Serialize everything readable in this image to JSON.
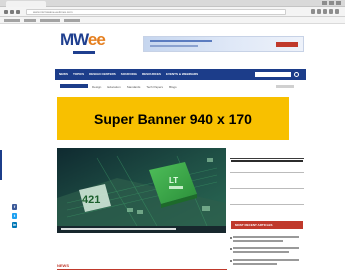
{
  "browser": {
    "url": "www.microwave-eetimes.com",
    "colors": {
      "chrome": "#d9d9d9",
      "toolbar": "#f4f4f4"
    }
  },
  "site": {
    "logo_primary": "MW",
    "logo_accent": "ee",
    "colors": {
      "brand_blue": "#1c3d8a",
      "accent_orange": "#e57f1f",
      "banner_yellow": "#f8c000",
      "accent_red": "#c0392b"
    }
  },
  "nav": {
    "items": [
      "NEWS",
      "TOPICS",
      "DESIGN CENTERS",
      "SOURCING",
      "RESOURCES",
      "EVENTS & WEBINARS"
    ],
    "search_placeholder": ""
  },
  "subnav": {
    "links": [
      "Design",
      "Education",
      "Standards",
      "Tech Papers",
      "Blogs"
    ]
  },
  "super_banner": {
    "text": "Super Banner   940 x 170"
  },
  "sidebar": {
    "section_title": "MOST RECENT ARTICLES"
  },
  "social": {
    "icons": [
      "facebook-icon",
      "twitter-icon",
      "linkedin-icon"
    ],
    "labels": [
      "f",
      "t",
      "in"
    ]
  },
  "section": {
    "news_label": "NEWS"
  }
}
